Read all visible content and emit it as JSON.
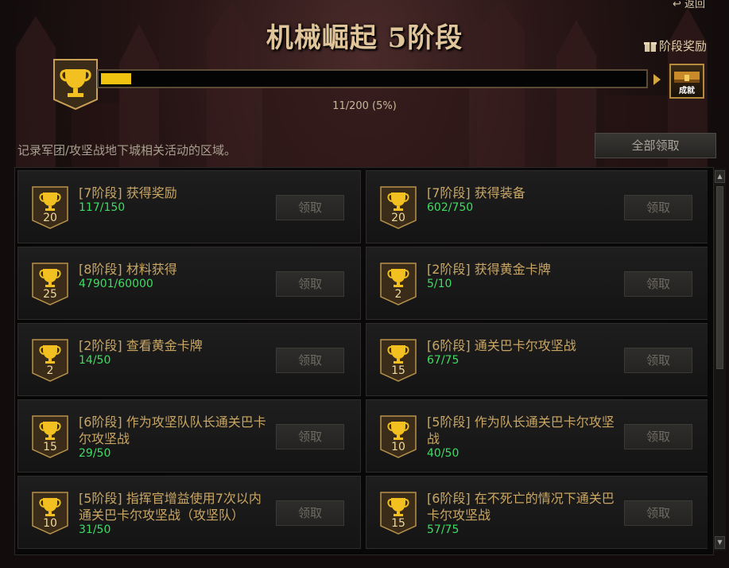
{
  "header": {
    "return_label": "返回",
    "title": "机械崛起 5阶段",
    "stage_reward_label": "阶段奖励",
    "chest_label": "成就"
  },
  "progress": {
    "text": "11/200 (5%)",
    "fraction": 0.055
  },
  "description": "记录军团/攻坚战地下城相关活动的区域。",
  "claim_all_label": "全部领取",
  "claim_label": "领取",
  "colors": {
    "accent_gold": "#f1c311",
    "progress_green": "#3fdc63",
    "title_gold": "#c9a664"
  },
  "achievements": [
    {
      "title": "[7阶段] 获得奖励",
      "progress": "117/150",
      "points": "20"
    },
    {
      "title": "[7阶段] 获得装备",
      "progress": "602/750",
      "points": "20"
    },
    {
      "title": "[8阶段] 材料获得",
      "progress": "47901/60000",
      "points": "25"
    },
    {
      "title": "[2阶段] 获得黄金卡牌",
      "progress": "5/10",
      "points": "2"
    },
    {
      "title": "[2阶段] 查看黄金卡牌",
      "progress": "14/50",
      "points": "2"
    },
    {
      "title": "[6阶段] 通关巴卡尔攻坚战",
      "progress": "67/75",
      "points": "15"
    },
    {
      "title": "[6阶段] 作为攻坚队队长通关巴卡尔攻坚战",
      "progress": "29/50",
      "points": "15"
    },
    {
      "title": "[5阶段] 作为队长通关巴卡尔攻坚战",
      "progress": "40/50",
      "points": "10"
    },
    {
      "title": "[5阶段] 指挥官增益使用7次以内通关巴卡尔攻坚战（攻坚队）",
      "progress": "31/50",
      "points": "10"
    },
    {
      "title": "[6阶段] 在不死亡的情况下通关巴卡尔攻坚战",
      "progress": "57/75",
      "points": "15"
    }
  ]
}
